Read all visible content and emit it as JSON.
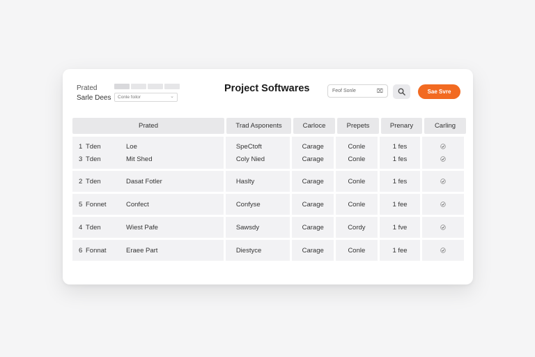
{
  "filters": {
    "label_top": "Prated",
    "label_bottom": "Sarle Dees",
    "select_value": "Conle foilor",
    "select_caret": "⌄"
  },
  "header": {
    "title": "Project Softwares",
    "search_placeholder": "Feof Sonle",
    "search_clear": "⌧",
    "cta_label": "Sae Svre"
  },
  "table": {
    "columns": [
      "Prated",
      "Trad Asponents",
      "Carloce",
      "Prepets",
      "Prenary",
      "Carling"
    ],
    "rows": [
      {
        "lines": [
          {
            "num": "1",
            "kind": "Tden",
            "name": "Loe",
            "component": "SpeCtoft",
            "status": "Carage",
            "ref": "Conle",
            "fee": "1 fes",
            "check": true
          },
          {
            "num": "3",
            "kind": "Tden",
            "name": "Mit Shed",
            "component": "Coly Nied",
            "status": "Carage",
            "ref": "Conle",
            "fee": "1 fes",
            "check": true
          }
        ]
      },
      {
        "lines": [
          {
            "num": "2",
            "kind": "Tden",
            "name": "Dasat Fotler",
            "component": "Haslty",
            "status": "Carage",
            "ref": "Conle",
            "fee": "1 fes",
            "check": true
          }
        ]
      },
      {
        "lines": [
          {
            "num": "5",
            "kind": "Fonnet",
            "name": "Confect",
            "component": "Confyse",
            "status": "Carage",
            "ref": "Conle",
            "fee": "1 fee",
            "check": true
          }
        ]
      },
      {
        "lines": [
          {
            "num": "4",
            "kind": "Tden",
            "name": "Wiest Pafe",
            "component": "Sawsdy",
            "status": "Carage",
            "ref": "Cordy",
            "fee": "1 fve",
            "check": true
          }
        ]
      },
      {
        "lines": [
          {
            "num": "6",
            "kind": "Fonnat",
            "name": "Eraee Part",
            "component": "Diestyce",
            "status": "Carage",
            "ref": "Conle",
            "fee": "1 fee",
            "check": true
          }
        ]
      }
    ]
  },
  "colors": {
    "accent": "#f26a21",
    "header_cell": "#e8e8ea",
    "row_cell": "#f2f2f4"
  },
  "icons": {
    "search": "search-icon",
    "check": "check-circle-icon"
  }
}
